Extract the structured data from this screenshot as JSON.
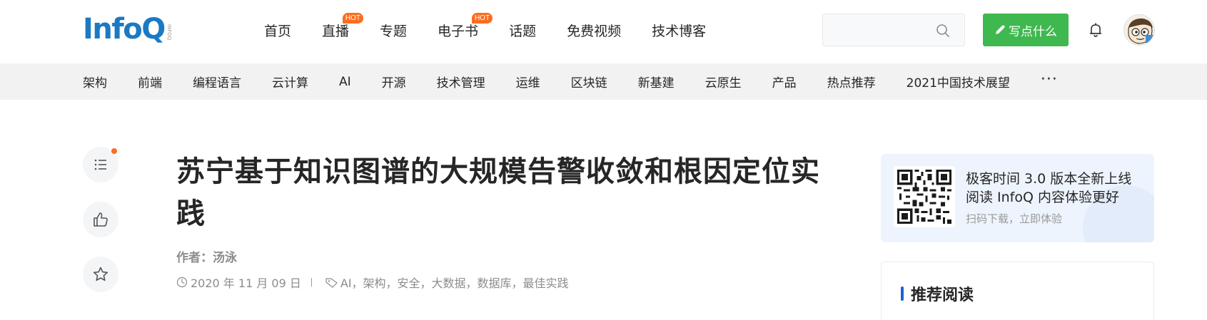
{
  "header": {
    "logo": "InfoQ",
    "logo_sub": "INFOQ",
    "nav": [
      {
        "label": "首页",
        "hot": ""
      },
      {
        "label": "直播",
        "hot": "HOT"
      },
      {
        "label": "专题",
        "hot": ""
      },
      {
        "label": "电子书",
        "hot": "HOT"
      },
      {
        "label": "话题",
        "hot": ""
      },
      {
        "label": "免费视频",
        "hot": ""
      },
      {
        "label": "技术博客",
        "hot": ""
      }
    ],
    "search_placeholder": "",
    "write_button": "写点什么"
  },
  "subnav": {
    "items": [
      "架构",
      "前端",
      "编程语言",
      "云计算",
      "AI",
      "开源",
      "技术管理",
      "运维",
      "区块链",
      "新基建",
      "云原生",
      "产品",
      "热点推荐",
      "2021中国技术展望"
    ],
    "more": "···"
  },
  "article": {
    "title": "苏宁基于知识图谱的大规模告警收敛和根因定位实践",
    "author": "作者：汤泳",
    "date": "2020 年 11 月 09 日",
    "tags": "AI，架构，安全，大数据，数据库，最佳实践"
  },
  "promo": {
    "line1": "极客时间 3.0 版本全新上线",
    "line2": "阅读 InfoQ 内容体验更好",
    "line3": "扫码下载，立即体验"
  },
  "recommend": {
    "title": "推荐阅读"
  },
  "colors": {
    "brand": "#1b79c4",
    "write_button": "#3eb84f",
    "hot_badge": "#fb6d1f",
    "recommend_bar": "#1b5fd9"
  }
}
